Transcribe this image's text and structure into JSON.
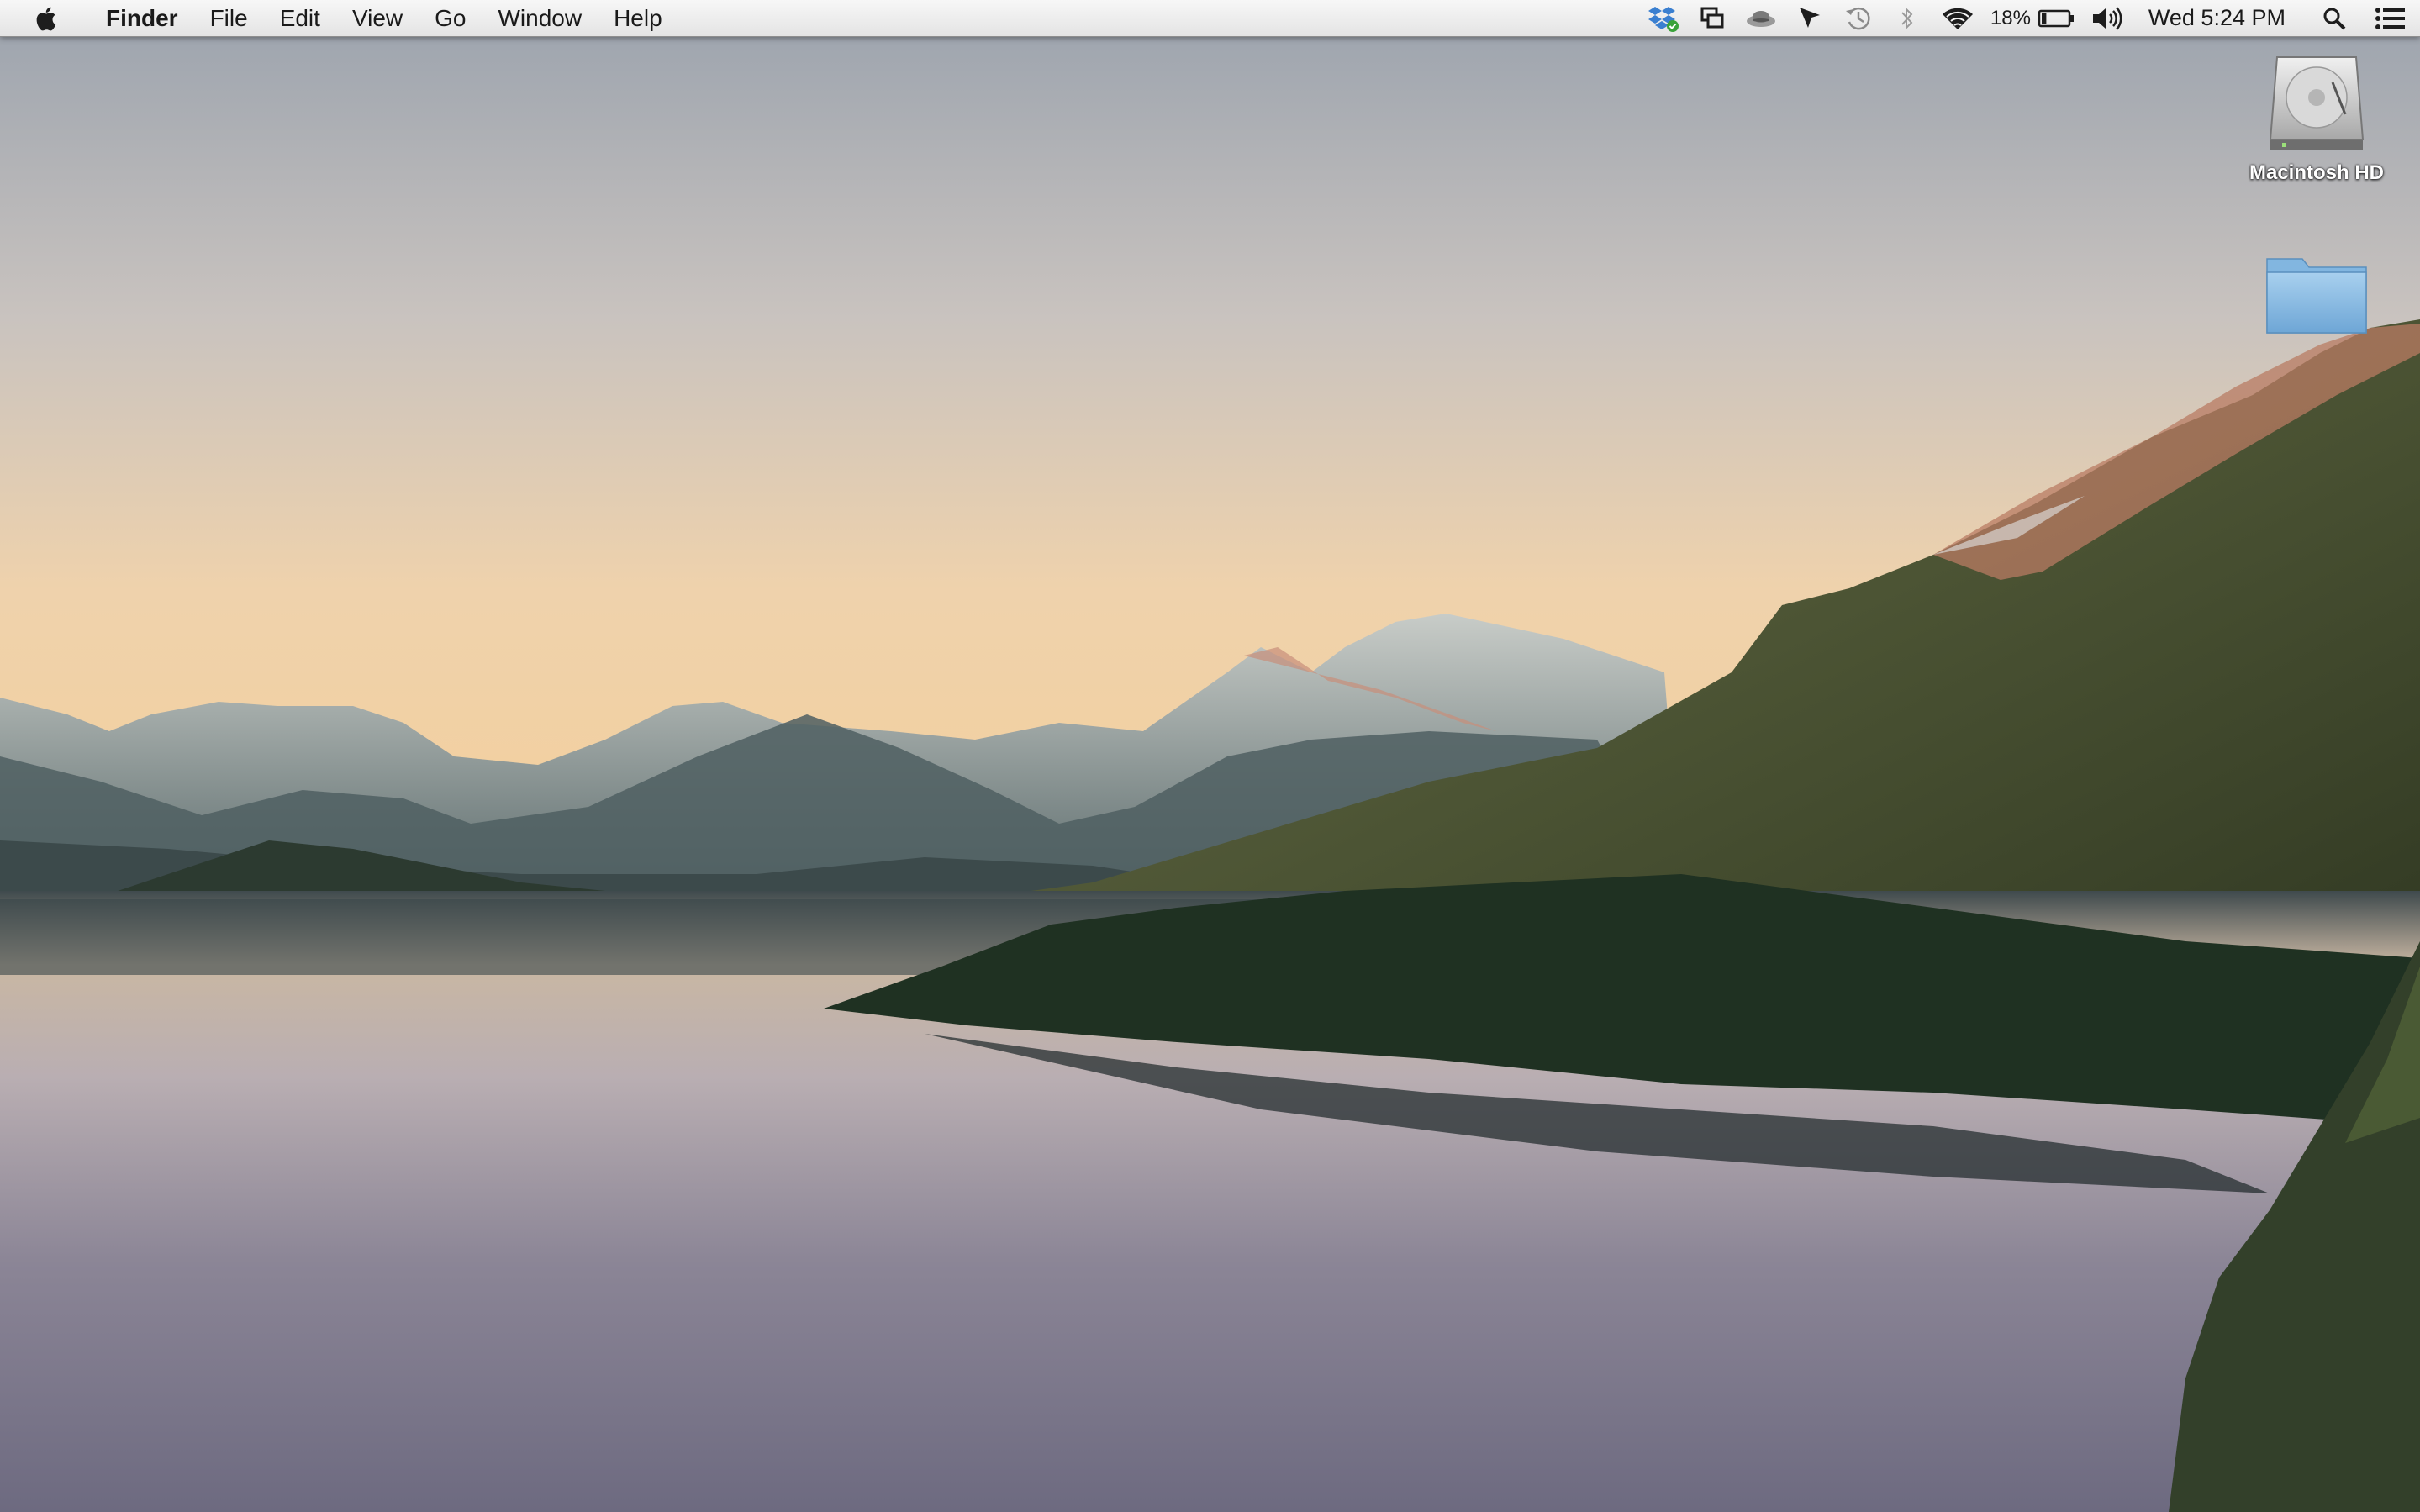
{
  "menubar": {
    "apple_icon": "apple-logo-icon",
    "app_name": "Finder",
    "menus": [
      "File",
      "Edit",
      "View",
      "Go",
      "Window",
      "Help"
    ],
    "status_icons": [
      "dropbox-icon",
      "display-mirroring-icon",
      "hat-icon",
      "cursor-arrow-icon",
      "time-machine-icon",
      "bluetooth-icon",
      "wifi-icon"
    ],
    "battery": {
      "percent_text": "18%",
      "level": 0.18
    },
    "volume_icon": "volume-icon",
    "clock": "Wed 5:24 PM",
    "spotlight_icon": "spotlight-search-icon",
    "notification_center_icon": "notification-list-icon"
  },
  "desktop": {
    "wallpaper": "mountain-lake-at-sunset",
    "icons": [
      {
        "label": "Macintosh HD",
        "icon": "hard-drive-icon"
      },
      {
        "label": "",
        "icon": "folder-icon"
      }
    ]
  }
}
